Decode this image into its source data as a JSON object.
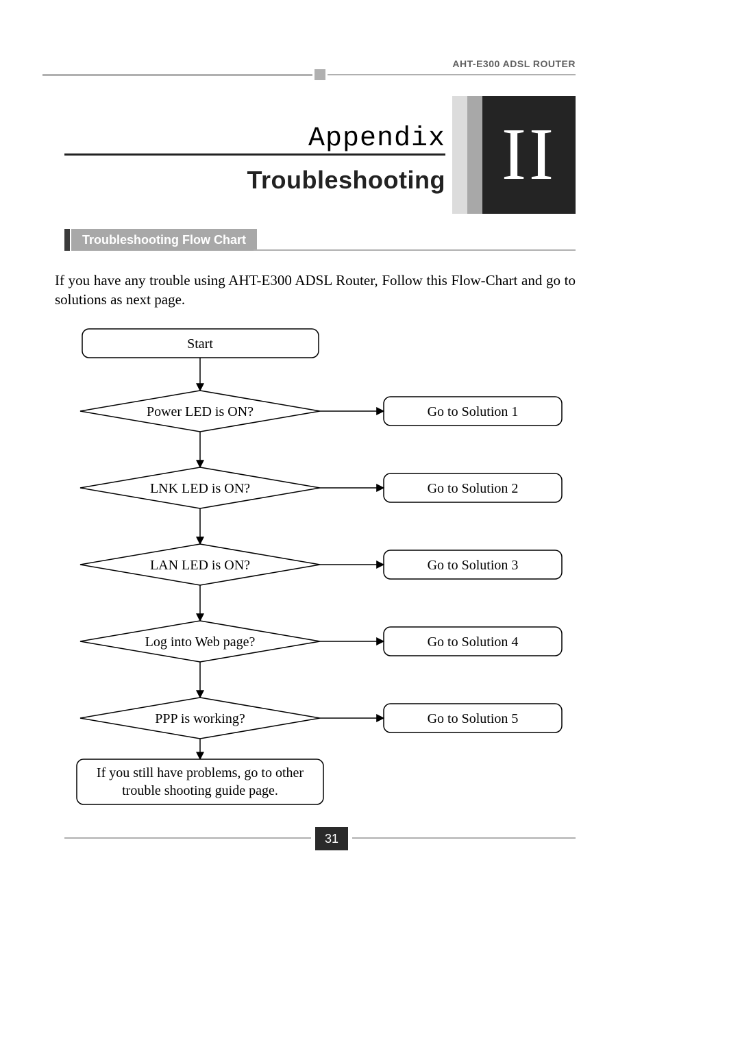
{
  "product_name": "AHT-E300 ADSL ROUTER",
  "chapter": {
    "label": "Appendix",
    "number": "II",
    "title": "Troubleshooting"
  },
  "section_title": "Troubleshooting Flow Chart",
  "intro_text": "If you have any trouble using AHT-E300 ADSL Router, Follow this Flow-Chart and go to solutions as next page.",
  "page_number": "31",
  "chart_data": {
    "type": "flowchart",
    "start": "Start",
    "end": "If you still have problems, go to other trouble shooting guide page.",
    "steps": [
      {
        "question": "Power LED is ON?",
        "solution": "Go to Solution 1"
      },
      {
        "question": "LNK LED is ON?",
        "solution": "Go to Solution 2"
      },
      {
        "question": "LAN LED is ON?",
        "solution": "Go to Solution 3"
      },
      {
        "question": "Log into Web page?",
        "solution": "Go to Solution 4"
      },
      {
        "question": "PPP is working?",
        "solution": "Go to Solution 5"
      }
    ]
  }
}
